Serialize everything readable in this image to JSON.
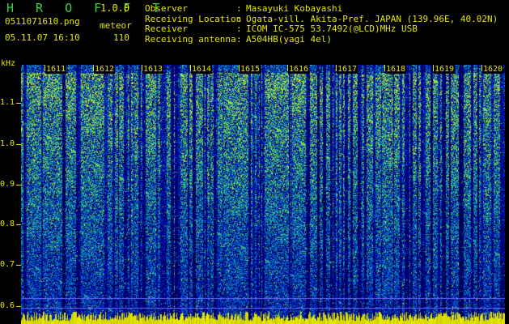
{
  "app": {
    "title": "H R O F F T",
    "version": "1.0.0"
  },
  "file": {
    "name": "0511071610.png",
    "mode": "meteor",
    "datetime": "05.11.07 16:10",
    "count": "110"
  },
  "info": [
    {
      "label": "Observer",
      "value": "Masayuki Kobayashi"
    },
    {
      "label": "Receiving Location",
      "value": "Ogata-vill. Akita-Pref. JAPAN (139.96E, 40.02N)"
    },
    {
      "label": "Receiver",
      "value": "ICOM IC-575 53.7492(@LCD)MHz USB"
    },
    {
      "label": "Receiving antenna",
      "value": "A504HB(yagi 4el)"
    }
  ],
  "axis": {
    "unit": "kHz",
    "y_labels": [
      "1.1",
      "1.0",
      "0.9",
      "0.8",
      "0.7",
      "0.6"
    ],
    "x_labels": [
      "1611",
      "1612",
      "1613",
      "1614",
      "1615",
      "1616",
      "1617",
      "1618",
      "1619",
      "1620"
    ]
  },
  "colors": {
    "label": "#e6e600",
    "title": "#39d14a",
    "background": "#000000"
  }
}
